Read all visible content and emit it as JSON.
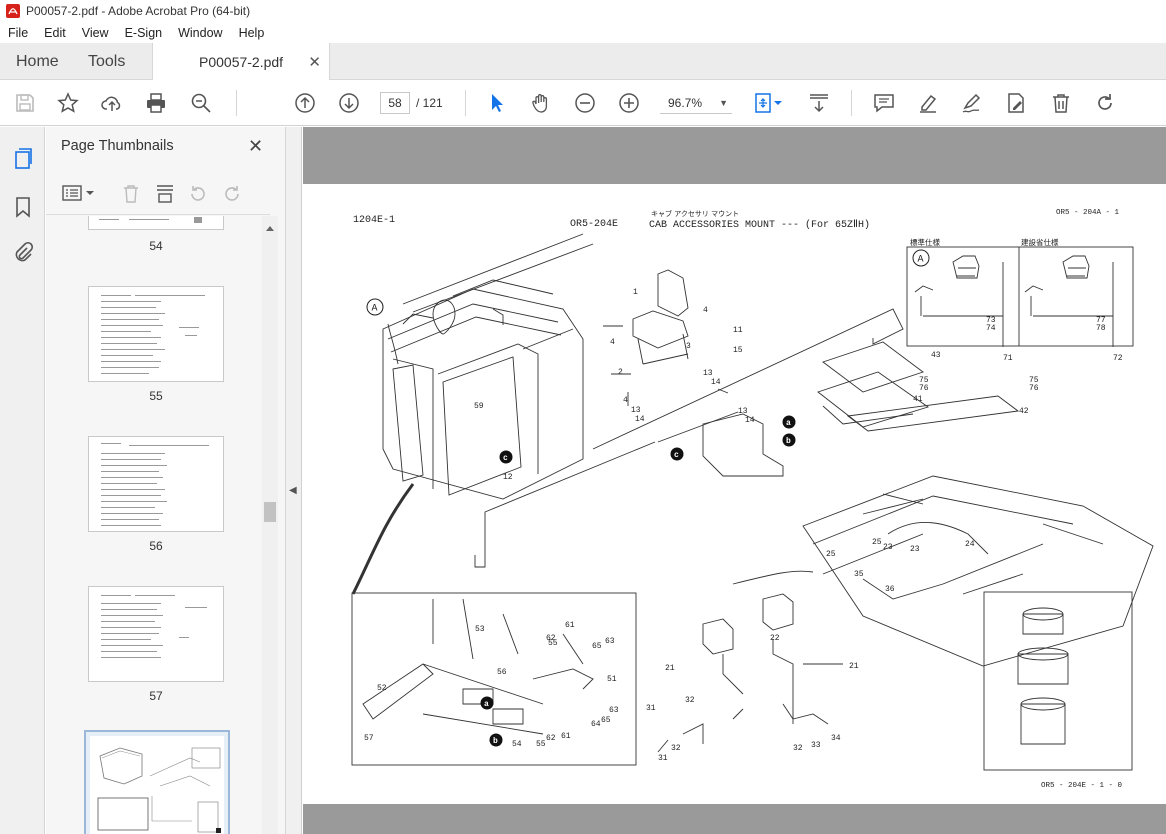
{
  "window": {
    "title": "P00057-2.pdf - Adobe Acrobat Pro (64-bit)"
  },
  "menu": [
    "File",
    "Edit",
    "View",
    "E-Sign",
    "Window",
    "Help"
  ],
  "tabs": {
    "home": "Home",
    "tools": "Tools",
    "document": "P00057-2.pdf"
  },
  "toolbar": {
    "page_current": "58",
    "page_total": "/  121",
    "zoom": "96.7%"
  },
  "thumbnails": {
    "title": "Page Thumbnails",
    "pages": [
      {
        "label": "54"
      },
      {
        "label": "55"
      },
      {
        "label": "56"
      },
      {
        "label": "57"
      }
    ]
  },
  "pdf_page": {
    "left_code": "1204E-1",
    "part_code": "OR5-204E",
    "title_jp": "キャブ アクセサリ マウント",
    "title_en": "CAB  ACCESSORIES  MOUNT --- (For 65ZⅡH)",
    "ref_code": "OR5 - 204A - 1",
    "inset_left_label": "標準仕様",
    "inset_right_label": "建設省仕様",
    "inset_marker": "A",
    "cab_marker": "A",
    "footer_code": "OR5 - 204E - 1 - 0",
    "callouts": [
      "1",
      "11",
      "15",
      "4",
      "4",
      "3",
      "13",
      "14",
      "2",
      "13",
      "14",
      "13",
      "14",
      "4",
      "73",
      "74",
      "71",
      "75",
      "76",
      "77",
      "78",
      "72",
      "75",
      "76",
      "43",
      "41",
      "42",
      "12",
      "59",
      "25",
      "25",
      "23",
      "23",
      "24",
      "35",
      "36",
      "22",
      "21",
      "21",
      "31",
      "32",
      "31",
      "32",
      "32",
      "33",
      "34",
      "61",
      "62",
      "55",
      "63",
      "65",
      "53",
      "56",
      "51",
      "52",
      "57",
      "54",
      "55",
      "62",
      "61",
      "64",
      "65",
      "63"
    ],
    "letter_markers": [
      "a",
      "b",
      "c",
      "c",
      "a",
      "b"
    ]
  }
}
